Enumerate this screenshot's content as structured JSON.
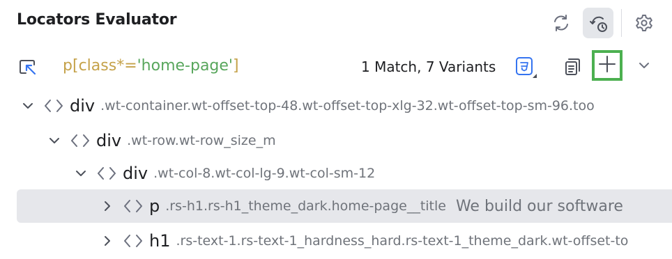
{
  "header": {
    "title": "Locators Evaluator",
    "icons": [
      "refresh-icon",
      "history-icon",
      "settings-icon"
    ]
  },
  "locator_bar": {
    "locator": {
      "tag": "p",
      "open_bracket": "[",
      "attr": "class",
      "operator": "*=",
      "value": "'home-page'",
      "close_bracket": "]"
    },
    "match_summary": "1 Match, 7 Variants",
    "icons": [
      "pick-element-icon",
      "css-icon",
      "copy-icon",
      "add-icon",
      "chevron-down-icon"
    ]
  },
  "tree": [
    {
      "tag": "div",
      "classes": ".wt-container.wt-offset-top-48.wt-offset-top-xlg-32.wt-offset-top-sm-96.too",
      "expanded": true,
      "depth": 0,
      "text": ""
    },
    {
      "tag": "div",
      "classes": ".wt-row.wt-row_size_m",
      "expanded": true,
      "depth": 1,
      "text": ""
    },
    {
      "tag": "div",
      "classes": ".wt-col-8.wt-col-lg-9.wt-col-sm-12",
      "expanded": true,
      "depth": 2,
      "text": ""
    },
    {
      "tag": "p",
      "classes": ".rs-h1.rs-h1_theme_dark.home-page__title",
      "expanded": false,
      "depth": 3,
      "selected": true,
      "text": "We build our software"
    },
    {
      "tag": "h1",
      "classes": ".rs-text-1.rs-text-1_hardness_hard.rs-text-1_theme_dark.wt-offset-to",
      "expanded": false,
      "depth": 3,
      "text": ""
    }
  ],
  "colors": {
    "add_button_border": "#4cb050",
    "selection_bg": "#e6e7eb",
    "locator_syntax": "#c5a24a",
    "locator_string": "#58a65c",
    "css_icon": "#3574f0"
  }
}
